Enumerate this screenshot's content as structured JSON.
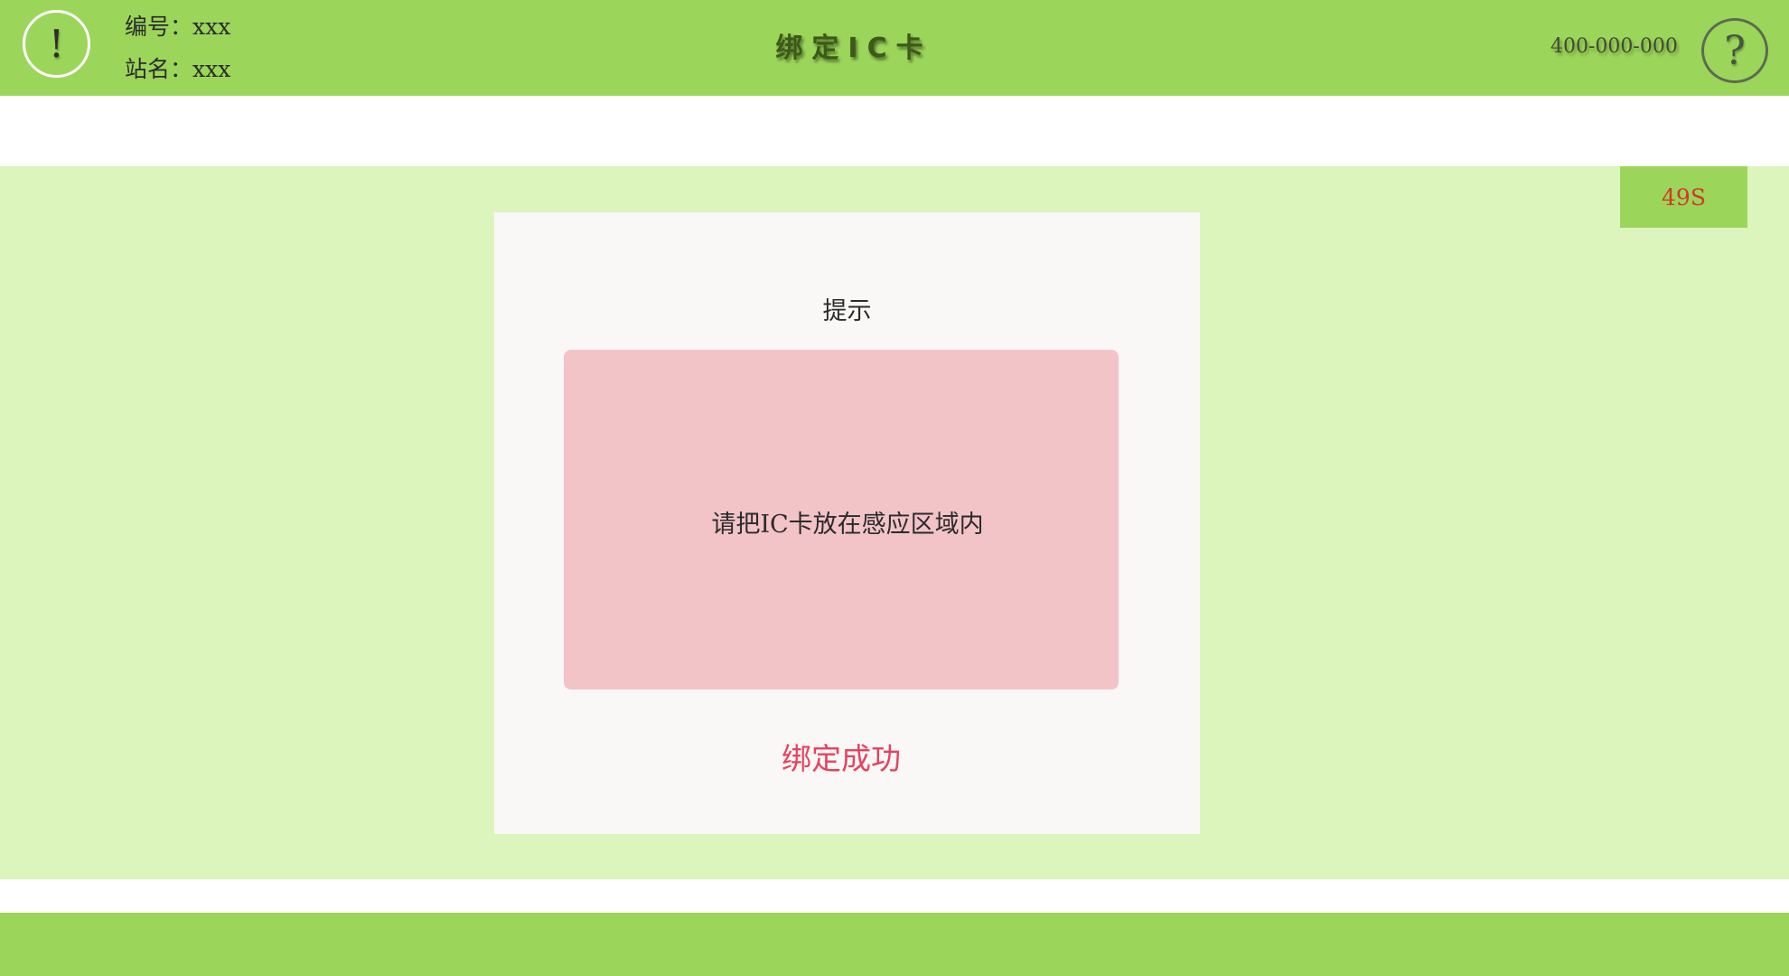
{
  "header": {
    "alert_icon": "!",
    "station_id_line": "编号：xxx",
    "station_name_line": "站名：xxx",
    "title": "绑定IC卡",
    "hotline": "400-000-000",
    "help_icon": "?"
  },
  "countdown": "49S",
  "dialog": {
    "title": "提示",
    "instruction": "请把IC卡放在感应区域内",
    "result": "绑定成功"
  },
  "colors": {
    "header_green": "#9bd65a",
    "main_background": "#dbf5bd",
    "reader_pink": "#f2c4c7",
    "success_red": "#e8415f",
    "countdown_red": "#d13a28"
  }
}
